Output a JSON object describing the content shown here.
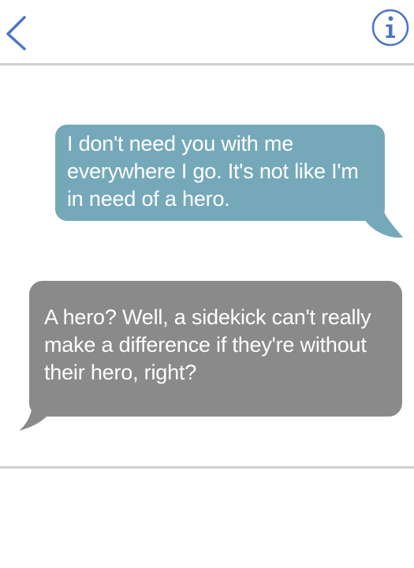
{
  "header": {
    "back_icon": "chevron-left-icon",
    "info_icon": "info-circle-icon"
  },
  "colors": {
    "accent": "#4a76c8",
    "outgoing_bubble": "#75a9b9",
    "incoming_bubble": "#8a8a8a",
    "divider": "#cfcfcf"
  },
  "messages": [
    {
      "direction": "outgoing",
      "text": "I don't need you with me everywhere I go. It's not like I'm in need of a hero."
    },
    {
      "direction": "incoming",
      "text": "A hero? Well, a sidekick can't really make a difference if they're without their hero, right?"
    }
  ]
}
